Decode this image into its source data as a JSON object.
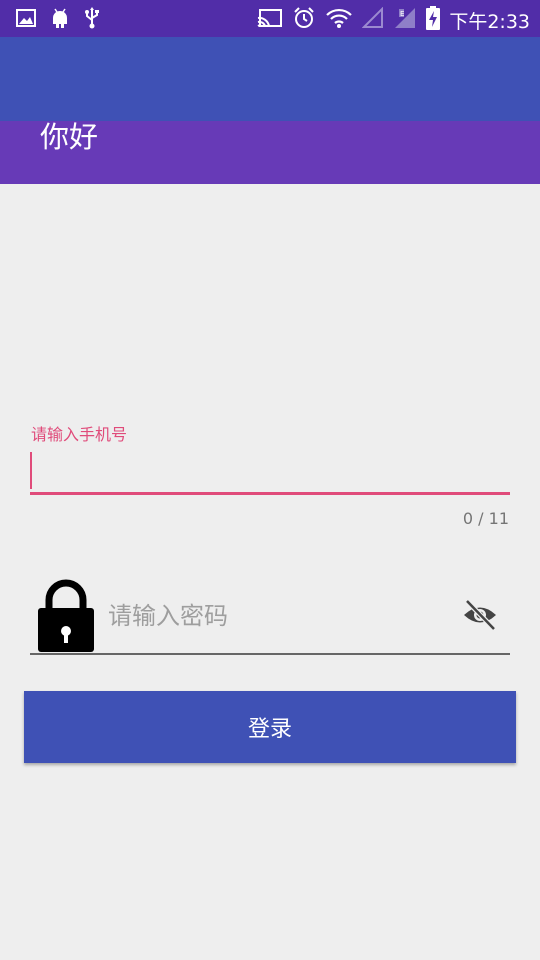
{
  "status_bar": {
    "time": "下午2:33",
    "icons_left": [
      "image-icon",
      "android-debug-icon",
      "usb-icon"
    ],
    "icons_right": [
      "cast-icon",
      "alarm-icon",
      "wifi-icon",
      "signal-empty-icon",
      "signal-icon",
      "battery-charging-icon"
    ]
  },
  "header": {
    "greeting": "你好"
  },
  "phone_field": {
    "label": "请输入手机号",
    "value": "",
    "counter": "0 / 11"
  },
  "password_field": {
    "placeholder": "请输入密码",
    "lock_icon": "lock-icon",
    "visibility_icon": "eye-off-icon"
  },
  "login_button": {
    "label": "登录"
  },
  "colors": {
    "status_bar": "#512da8",
    "toolbar": "#3f51b5",
    "header_band": "#673ab7",
    "accent": "#e04b7a",
    "background": "#eeeeee",
    "button": "#3f51b5"
  }
}
